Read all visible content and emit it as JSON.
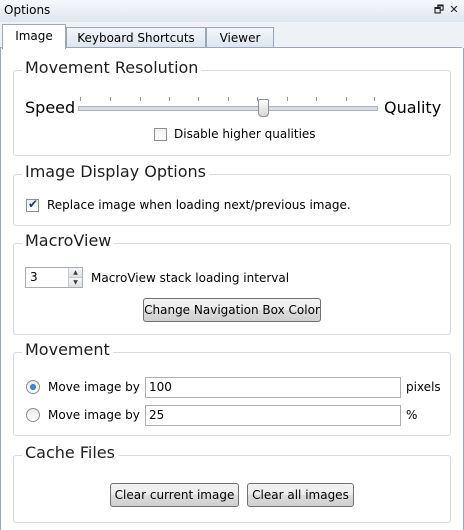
{
  "window": {
    "title": "Options",
    "restore_icon": "restore-icon",
    "close_icon": "close-icon"
  },
  "tabs": [
    {
      "label": "Image",
      "active": true
    },
    {
      "label": "Keyboard Shortcuts",
      "active": false
    },
    {
      "label": "Viewer",
      "active": false
    }
  ],
  "movement_resolution": {
    "title": "Movement Resolution",
    "left_label": "Speed",
    "right_label": "Quality",
    "slider_level": 0.61,
    "disable_higher_label": "Disable higher qualities",
    "disable_higher_checked": false
  },
  "image_display": {
    "title": "Image Display Options",
    "replace_label": "Replace image when loading next/previous image.",
    "replace_checked": true
  },
  "macroview": {
    "title": "MacroView",
    "interval_value": "3",
    "interval_label": "MacroView stack loading interval",
    "color_button": "Change Navigation Box Color"
  },
  "movement": {
    "title": "Movement",
    "rows": [
      {
        "label": "Move image by",
        "value": "100",
        "unit": "pixels",
        "selected": true
      },
      {
        "label": "Move image by",
        "value": "25",
        "unit": "%",
        "selected": false
      }
    ]
  },
  "cache": {
    "title": "Cache Files",
    "clear_current": "Clear current image",
    "clear_all": "Clear all images"
  }
}
